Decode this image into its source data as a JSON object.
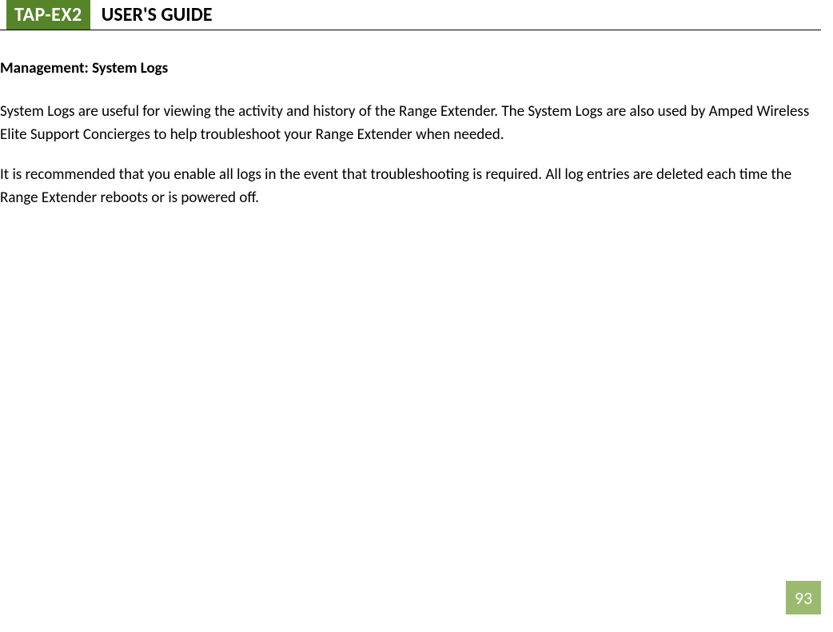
{
  "header": {
    "badge": "TAP-EX2",
    "title": "USER'S GUIDE"
  },
  "section": {
    "heading": "Management: System Logs",
    "paragraph1": "System Logs are useful for viewing the activity and history of the Range Extender. The System Logs are also used by Amped Wireless Elite Support Concierges to help troubleshoot your Range Extender when needed.",
    "paragraph2": "It is recommended that you enable all logs in the event that troubleshooting is required. All log entries are deleted each time the Range Extender reboots or is powered off."
  },
  "page_number": "93"
}
